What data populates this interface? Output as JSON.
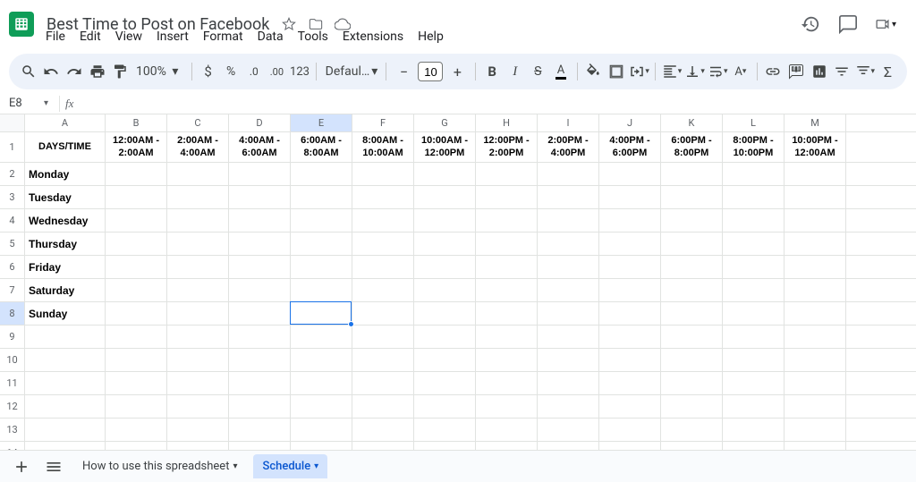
{
  "doc": {
    "name": "Best Time to Post on Facebook"
  },
  "menus": {
    "file": "File",
    "edit": "Edit",
    "view": "View",
    "insert": "Insert",
    "format": "Format",
    "data": "Data",
    "tools": "Tools",
    "extensions": "Extensions",
    "help": "Help"
  },
  "toolbar": {
    "zoom": "100%",
    "font": "Defaul…",
    "fontsize": "10"
  },
  "namebox": {
    "ref": "E8"
  },
  "columns": [
    "A",
    "B",
    "C",
    "D",
    "E",
    "F",
    "G",
    "H",
    "I",
    "J",
    "K",
    "L",
    "M"
  ],
  "selected_col_index": 4,
  "selected_row_index": 7,
  "row_count": 15,
  "headers_row": {
    "a": "DAYS/TIME",
    "b": "12:00AM - 2:00AM",
    "c": "2:00AM - 4:00AM",
    "d": "4:00AM - 6:00AM",
    "e": "6:00AM - 8:00AM",
    "f": "8:00AM - 10:00AM",
    "g": "10:00AM - 12:00PM",
    "h": "12:00PM - 2:00PM",
    "i": "2:00PM - 4:00PM",
    "j": "4:00PM - 6:00PM",
    "k": "6:00PM - 8:00PM",
    "l": "8:00PM - 10:00PM",
    "m": "10:00PM - 12:00AM"
  },
  "days": {
    "r2": "Monday",
    "r3": "Tuesday",
    "r4": "Wednesday",
    "r5": "Thursday",
    "r6": "Friday",
    "r7": "Saturday",
    "r8": "Sunday"
  },
  "sheets": {
    "tab1": "How to use this spreadsheet",
    "tab2": "Schedule"
  }
}
